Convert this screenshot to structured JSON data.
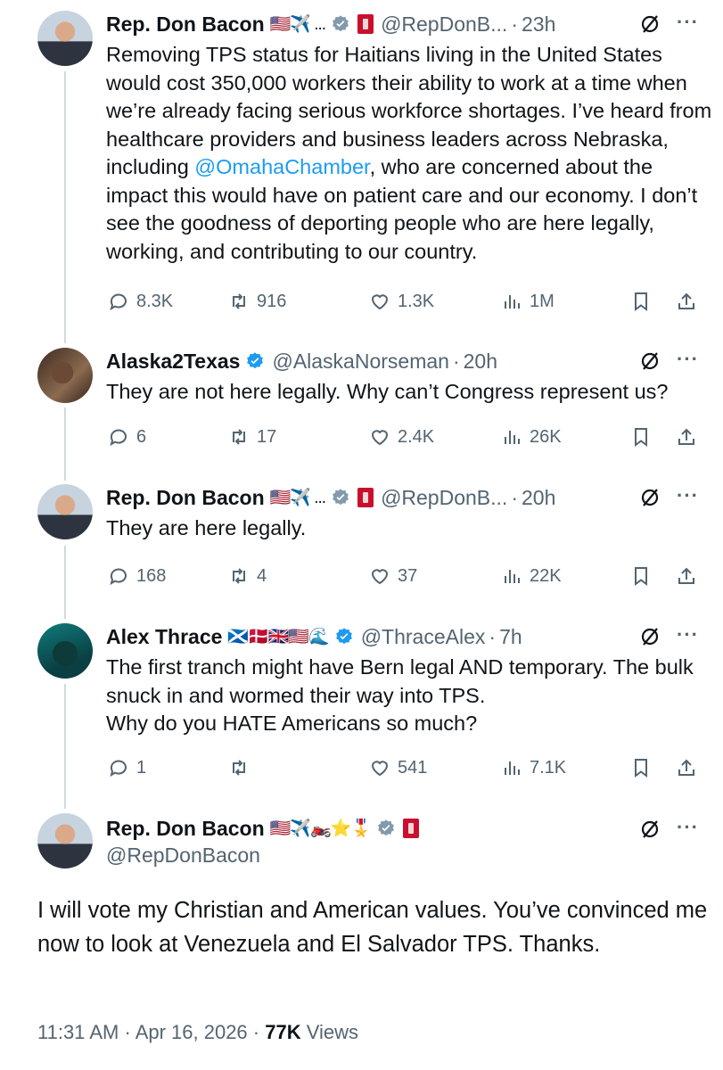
{
  "tweets": [
    {
      "name": "Rep. Don Bacon",
      "flags": "🇺🇸✈️ ...",
      "handle": "@RepDonB...",
      "time": "23h",
      "text": "Removing TPS status for Haitians living in the United States would cost 350,000 workers their ability to work at a time when we’re already facing serious workforce shortages. I’ve heard from healthcare providers and business leaders across Nebraska, including ",
      "mention": "@OmahaChamber",
      "text_after": ", who are concerned about the impact this would have on patient care and our economy. I don’t see the goodness of deporting people who are here legally, working, and contributing to our country.",
      "replies": "8.3K",
      "reposts": "916",
      "likes": "1.3K",
      "views": "1M"
    },
    {
      "name": "Alaska2Texas",
      "handle": "@AlaskaNorseman",
      "time": "20h",
      "text": "They are not here legally. Why can’t Congress represent us?",
      "replies": "6",
      "reposts": "17",
      "likes": "2.4K",
      "views": "26K"
    },
    {
      "name": "Rep. Don Bacon",
      "flags": "🇺🇸✈️ ...",
      "handle": "@RepDonB...",
      "time": "20h",
      "text": "They are here legally.",
      "replies": "168",
      "reposts": "4",
      "likes": "37",
      "views": "22K"
    },
    {
      "name": "Alex Thrace",
      "flags": "🏴󠁧󠁢󠁳󠁣󠁴󠁿🇩🇰🇬🇧🇺🇸🌊",
      "handle": "@ThraceAlex",
      "time": "7h",
      "text": "The first tranch might have Bern legal AND temporary. The bulk snuck in and wormed their way into TPS.\nWhy do you HATE Americans so much?",
      "replies": "1",
      "reposts": "",
      "likes": "541",
      "views": "7.1K"
    }
  ],
  "main": {
    "name": "Rep. Don Bacon",
    "flags": "🇺🇸✈️🏍️⭐🎖️",
    "handle": "@RepDonBacon",
    "text": "I will vote my Christian and American values. You’ve convinced me now to look at Venezuela and El Salvador TPS. Thanks.",
    "time": "11:31 AM",
    "date": "Apr 16, 2026",
    "views_count": "77K",
    "views_label": "Views"
  },
  "colors": {
    "accent": "#1d9bf0",
    "text": "#0f1419",
    "muted": "#536471",
    "thread": "#cfd9de",
    "badge_red": "#c8102e"
  },
  "icons": [
    "reply-icon",
    "repost-icon",
    "like-icon",
    "views-icon",
    "bookmark-icon",
    "share-icon",
    "grok-icon",
    "more-icon",
    "verified-badge-icon"
  ]
}
